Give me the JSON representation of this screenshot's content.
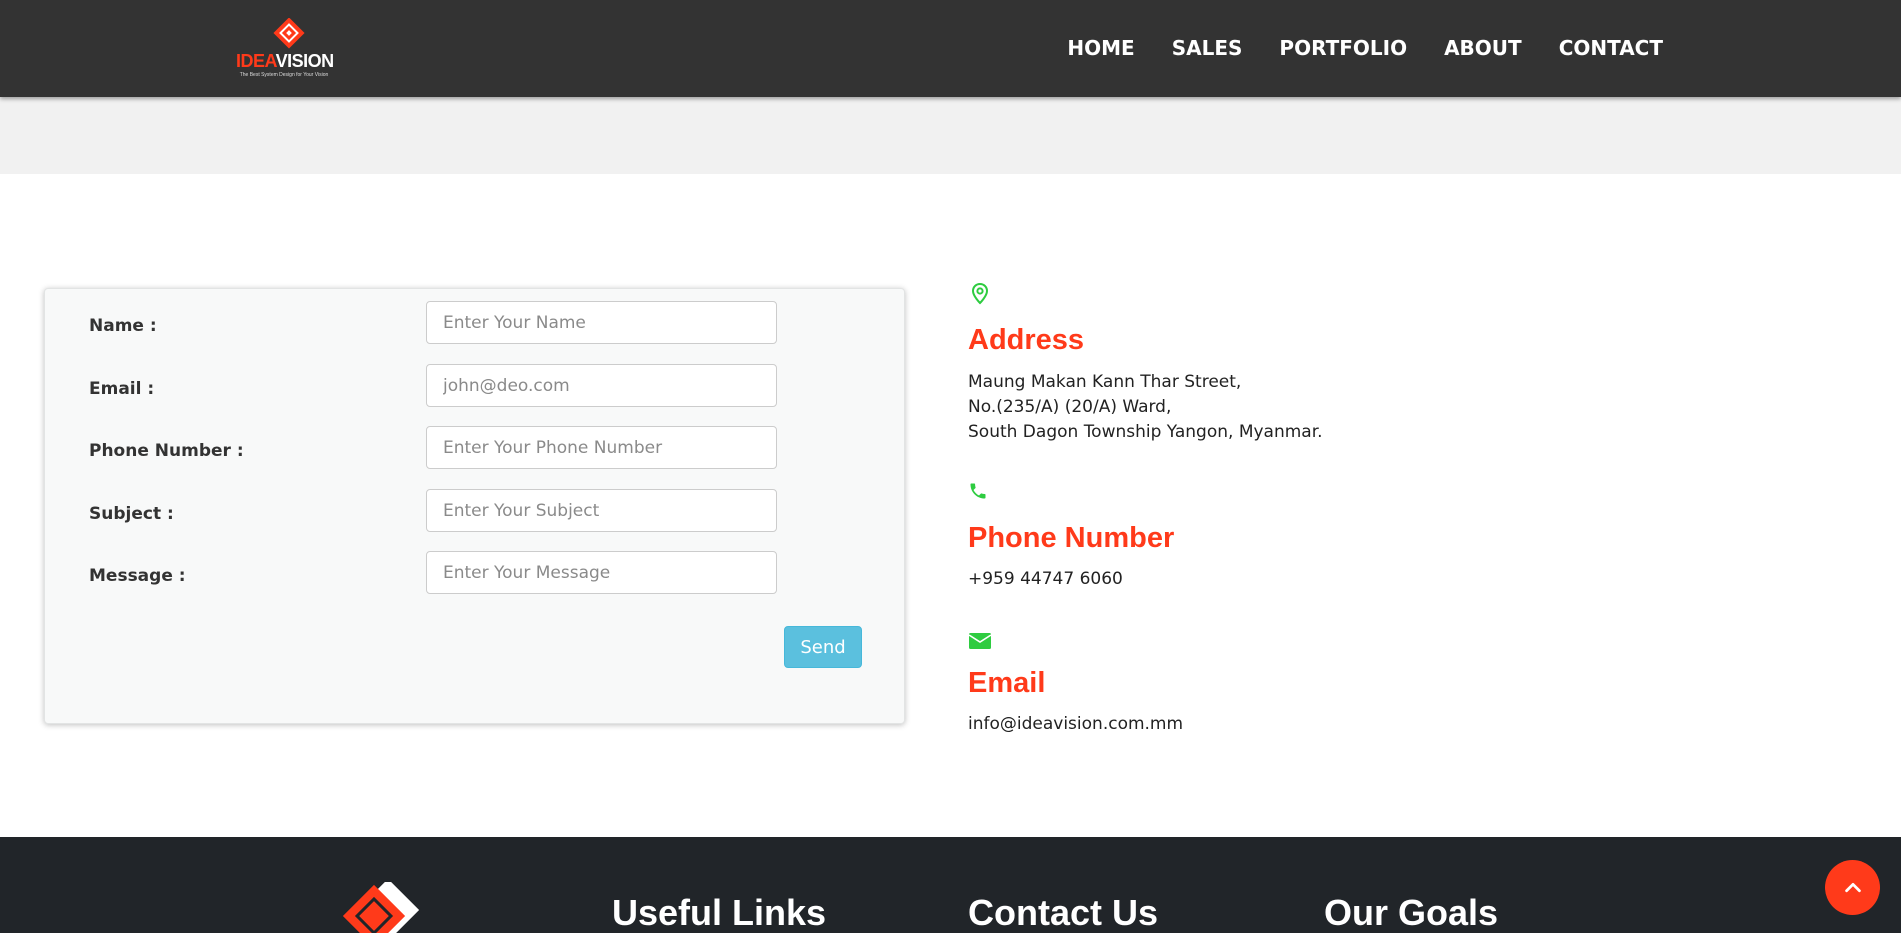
{
  "brand": {
    "logo_idea": "IDEA",
    "logo_vision": "VISION",
    "tagline": "The Best System Design for Your Vision"
  },
  "nav": {
    "items": [
      "HOME",
      "SALES",
      "PORTFOLIO",
      "ABOUT",
      "CONTACT"
    ]
  },
  "form": {
    "name_label": "Name :",
    "name_placeholder": "Enter Your Name",
    "email_label": "Email :",
    "email_placeholder": "john@deo.com",
    "phone_label": "Phone Number :",
    "phone_placeholder": "Enter Your Phone Number",
    "subject_label": "Subject :",
    "subject_placeholder": "Enter Your Subject",
    "message_label": "Message :",
    "message_placeholder": "Enter Your Message",
    "send_label": "Send"
  },
  "contact": {
    "address_title": "Address",
    "address_lines": [
      "Maung Makan Kann Thar Street,",
      "No.(235/A) (20/A) Ward,",
      "South Dagon Township Yangon, Myanmar."
    ],
    "phone_title": "Phone Number",
    "phone_value": "+959 44747 6060",
    "email_title": "Email",
    "email_value": "info@ideavision.com.mm"
  },
  "footer": {
    "headings": [
      "Useful Links",
      "Contact Us",
      "Our Goals"
    ]
  },
  "icons": {
    "location": "map-pin-icon",
    "phone": "phone-icon",
    "email": "envelope-icon",
    "to_top": "chevron-up-icon"
  },
  "colors": {
    "navbar": "#333333",
    "accent": "#ff3a1a",
    "icon_green": "#2ecc40",
    "send_button": "#5bc0de",
    "footer": "#212529"
  }
}
